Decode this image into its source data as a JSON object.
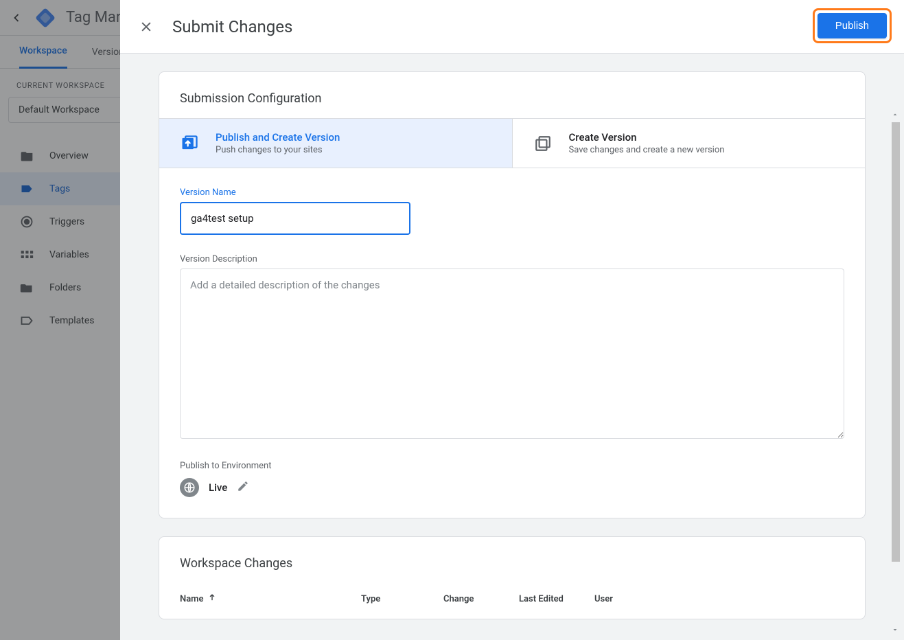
{
  "bg": {
    "title": "Tag Manager",
    "tabs": {
      "workspace": "Workspace",
      "versions": "Versions"
    },
    "current_ws_label": "CURRENT WORKSPACE",
    "ws_name": "Default Workspace",
    "nav": {
      "overview": "Overview",
      "tags": "Tags",
      "triggers": "Triggers",
      "variables": "Variables",
      "folders": "Folders",
      "templates": "Templates"
    }
  },
  "modal": {
    "title": "Submit Changes",
    "publish_btn": "Publish",
    "config_title": "Submission Configuration",
    "choice1": {
      "title": "Publish and Create Version",
      "sub": "Push changes to your sites"
    },
    "choice2": {
      "title": "Create Version",
      "sub": "Save changes and create a new version"
    },
    "version_name_label": "Version Name",
    "version_name_value": "ga4test setup",
    "version_desc_label": "Version Description",
    "version_desc_placeholder": "Add a detailed description of the changes",
    "env_label": "Publish to Environment",
    "env_name": "Live",
    "ws_changes_title": "Workspace Changes",
    "table": {
      "name": "Name",
      "type": "Type",
      "change": "Change",
      "last_edited": "Last Edited",
      "user": "User"
    }
  }
}
